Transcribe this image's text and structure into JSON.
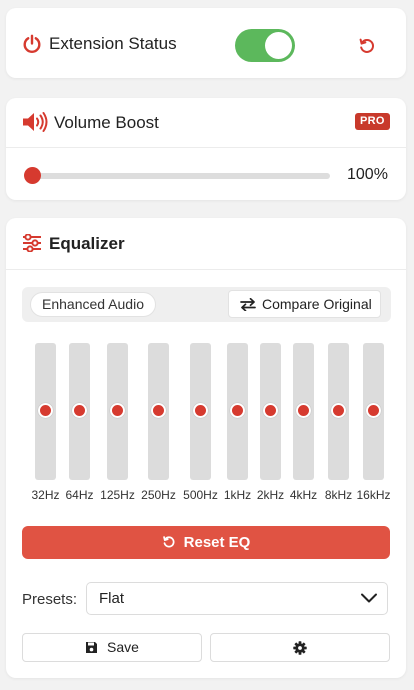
{
  "colors": {
    "accent": "#d63a2f",
    "toggle_on": "#5cb85c",
    "reset_button": "#e05343",
    "pro_badge": "#c8392b"
  },
  "status_card": {
    "title": "Extension Status",
    "icon": "power-icon",
    "toggle_on": true,
    "reset_icon": "undo-icon"
  },
  "volume_card": {
    "title": "Volume Boost",
    "icon": "speaker-icon",
    "badge": "PRO",
    "value_label": "100%",
    "slider_fraction": 0
  },
  "equalizer": {
    "title": "Equalizer",
    "icon": "sliders-icon",
    "mode_enhanced": "Enhanced Audio",
    "mode_compare": "Compare Original",
    "bands": [
      {
        "label": "32Hz",
        "gain_db": 0
      },
      {
        "label": "64Hz",
        "gain_db": 0
      },
      {
        "label": "125Hz",
        "gain_db": 0
      },
      {
        "label": "250Hz",
        "gain_db": 0
      },
      {
        "label": "500Hz",
        "gain_db": 0
      },
      {
        "label": "1kHz",
        "gain_db": 0
      },
      {
        "label": "2kHz",
        "gain_db": 0
      },
      {
        "label": "4kHz",
        "gain_db": 0
      },
      {
        "label": "8kHz",
        "gain_db": 0
      },
      {
        "label": "16kHz",
        "gain_db": 0
      }
    ],
    "reset_label": "Reset EQ",
    "presets_label": "Presets:",
    "preset_selected": "Flat",
    "save_label": "Save",
    "settings_icon": "gear-icon"
  }
}
